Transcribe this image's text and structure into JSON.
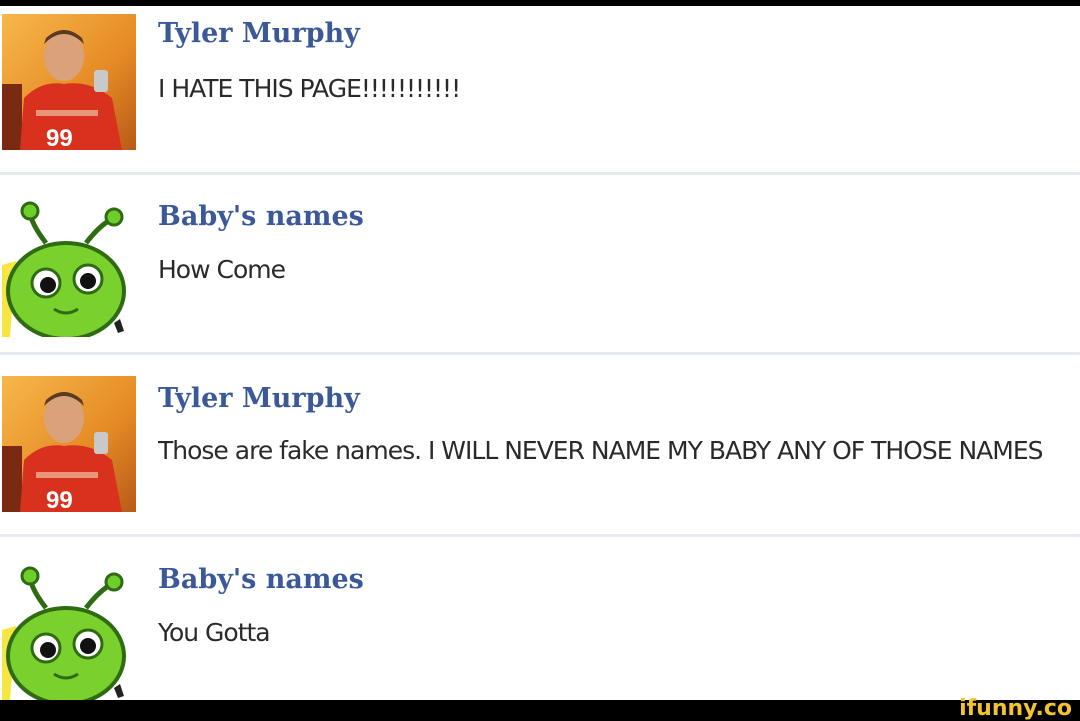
{
  "posts": [
    {
      "author": "Tyler Murphy",
      "message": "I HATE THIS PAGE!!!!!!!!!!!",
      "avatar_icon": "profile-photo"
    },
    {
      "author": "Baby's names",
      "message": "How Come",
      "avatar_icon": "green-alien-icon"
    },
    {
      "author": "Tyler Murphy",
      "message": "Those are fake names. I WILL NEVER NAME MY BABY ANY OF THOSE NAMES",
      "avatar_icon": "profile-photo"
    },
    {
      "author": "Baby's names",
      "message": "You Gotta",
      "avatar_icon": "green-alien-icon"
    }
  ],
  "footer": {
    "watermark": "ifunny.co"
  },
  "colors": {
    "name": "#3b5998",
    "message": "#2a2a2a",
    "background": "#ffffff",
    "watermark": "#f4c430"
  }
}
